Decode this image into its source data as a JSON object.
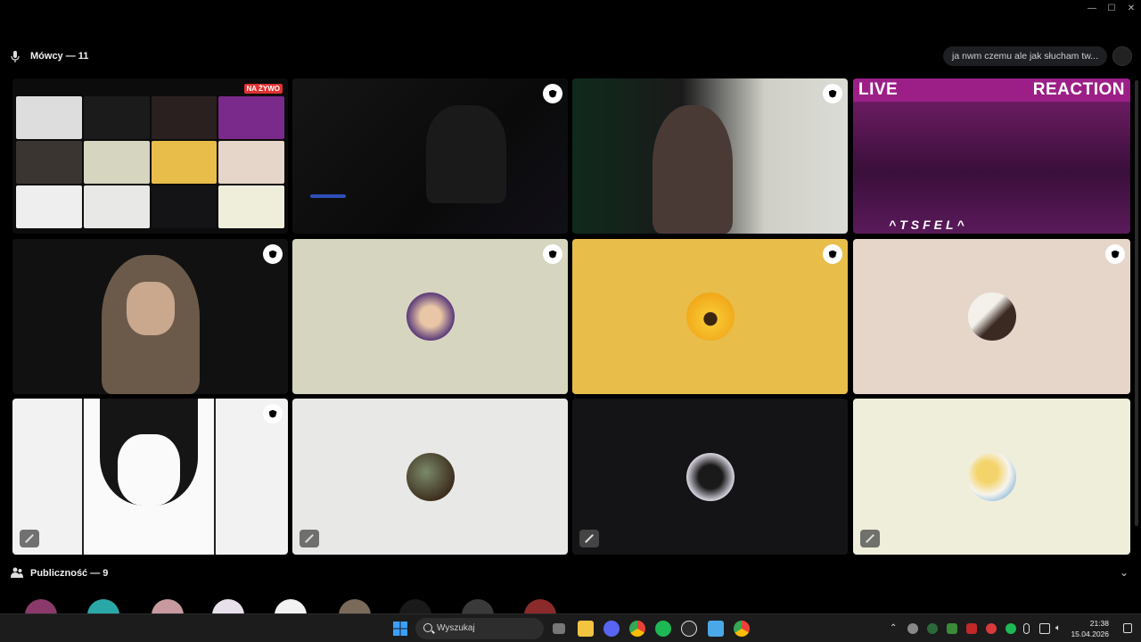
{
  "stage": {
    "title": "Mówcy — 11",
    "topic": "ja nwm czemu ale jak słucham tw..."
  },
  "tiles": {
    "screen_share": {
      "badge": "NA ŻYWO"
    },
    "stream_banner": {
      "left": "LIVE",
      "right": "REACTION",
      "bottom": "^TSFEL^"
    }
  },
  "audience": {
    "title": "Publiczność — 9"
  },
  "taskbar": {
    "search_placeholder": "Wyszukaj",
    "time": "21:38",
    "date": "15.04.2026"
  },
  "colors": {
    "tile_beige": "#d6d5c0",
    "tile_yellow": "#e8bd4a",
    "tile_pink": "#e6d6c9",
    "tile_light": "#e8e8e6",
    "tile_dark": "#141416",
    "tile_cream": "#efeedb"
  }
}
